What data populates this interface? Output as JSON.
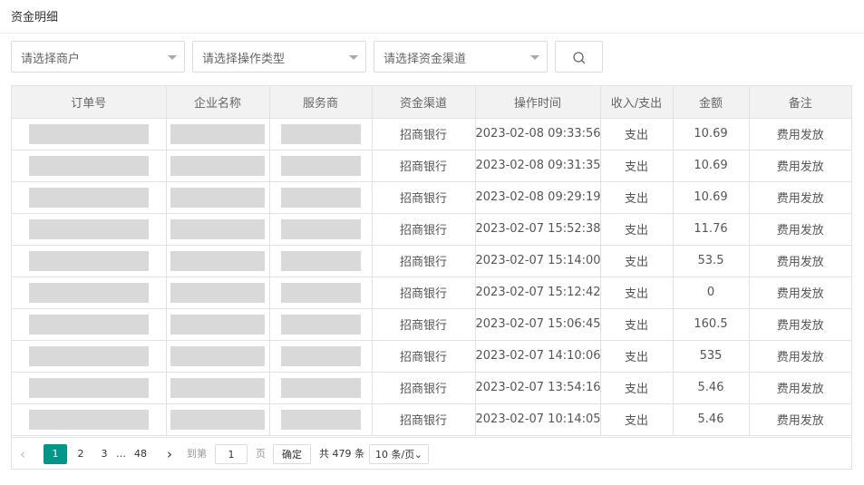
{
  "page": {
    "title": "资金明细"
  },
  "filters": {
    "merchant_placeholder": "请选择商户",
    "op_type_placeholder": "请选择操作类型",
    "channel_placeholder": "请选择资金渠道",
    "search_icon": "search-icon"
  },
  "table": {
    "columns": [
      "订单号",
      "企业名称",
      "服务商",
      "资金渠道",
      "操作时间",
      "收入/支出",
      "金额",
      "备注"
    ],
    "rows": [
      {
        "channel": "招商银行",
        "time": "2023-02-08 09:33:56",
        "direction": "支出",
        "amount": "10.69",
        "remark": "费用发放"
      },
      {
        "channel": "招商银行",
        "time": "2023-02-08 09:31:35",
        "direction": "支出",
        "amount": "10.69",
        "remark": "费用发放"
      },
      {
        "channel": "招商银行",
        "time": "2023-02-08 09:29:19",
        "direction": "支出",
        "amount": "10.69",
        "remark": "费用发放"
      },
      {
        "channel": "招商银行",
        "time": "2023-02-07 15:52:38",
        "direction": "支出",
        "amount": "11.76",
        "remark": "费用发放"
      },
      {
        "channel": "招商银行",
        "time": "2023-02-07 15:14:00",
        "direction": "支出",
        "amount": "53.5",
        "remark": "费用发放"
      },
      {
        "channel": "招商银行",
        "time": "2023-02-07 15:12:42",
        "direction": "支出",
        "amount": "0",
        "remark": "费用发放"
      },
      {
        "channel": "招商银行",
        "time": "2023-02-07 15:06:45",
        "direction": "支出",
        "amount": "160.5",
        "remark": "费用发放"
      },
      {
        "channel": "招商银行",
        "time": "2023-02-07 14:10:06",
        "direction": "支出",
        "amount": "535",
        "remark": "费用发放"
      },
      {
        "channel": "招商银行",
        "time": "2023-02-07 13:54:16",
        "direction": "支出",
        "amount": "5.46",
        "remark": "费用发放"
      },
      {
        "channel": "招商银行",
        "time": "2023-02-07 10:14:05",
        "direction": "支出",
        "amount": "5.46",
        "remark": "费用发放"
      }
    ]
  },
  "pagination": {
    "prev_icon": "chevron-left-icon",
    "pages": [
      "1",
      "2",
      "3"
    ],
    "ellipsis": "…",
    "last_page": "48",
    "next_icon": "chevron-right-icon",
    "goto_label": "到第",
    "goto_value": "1",
    "page_unit": "页",
    "confirm_label": "确定",
    "total_text": "共 479 条",
    "page_size": "10 条/页",
    "active_color": "#009688"
  }
}
